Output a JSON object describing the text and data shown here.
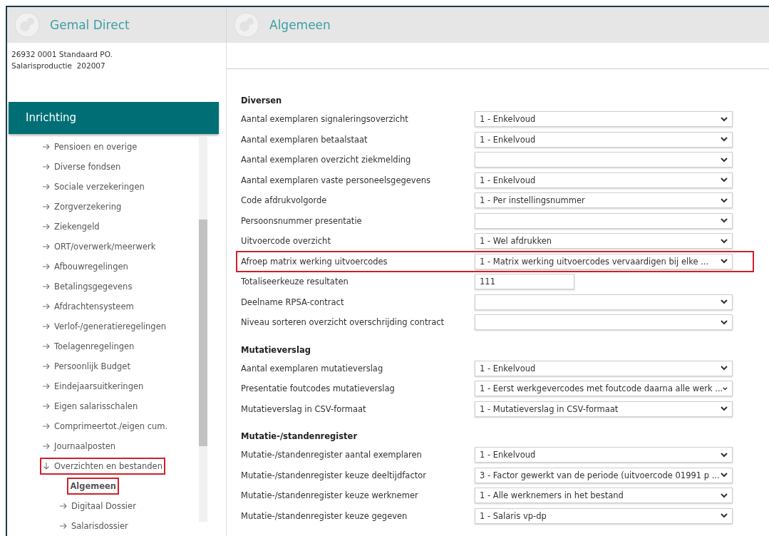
{
  "app_title": "Gemal Direct",
  "page_title": "Algemeen",
  "context": [
    "26932 0001 Standaard PO.",
    "Salarisproductie  202007"
  ],
  "nav_header": "Inrichting",
  "tree": [
    {
      "label": "Pensioen en overige",
      "expanded": false,
      "highlighted": false
    },
    {
      "label": "Diverse fondsen",
      "expanded": false,
      "highlighted": false
    },
    {
      "label": "Sociale verzekeringen",
      "expanded": false,
      "highlighted": false
    },
    {
      "label": "Zorgverzekering",
      "expanded": false,
      "highlighted": false
    },
    {
      "label": "Ziekengeld",
      "expanded": false,
      "highlighted": false
    },
    {
      "label": "ORT/overwerk/meerwerk",
      "expanded": false,
      "highlighted": false
    },
    {
      "label": "Afbouwregelingen",
      "expanded": false,
      "highlighted": false
    },
    {
      "label": "Betalingsgegevens",
      "expanded": false,
      "highlighted": false
    },
    {
      "label": "Afdrachtensysteem",
      "expanded": false,
      "highlighted": false
    },
    {
      "label": "Verlof-/generatieregelingen",
      "expanded": false,
      "highlighted": false
    },
    {
      "label": "Toelagenregelingen",
      "expanded": false,
      "highlighted": false
    },
    {
      "label": "Persoonlijk Budget",
      "expanded": false,
      "highlighted": false
    },
    {
      "label": "Eindejaarsuitkeringen",
      "expanded": false,
      "highlighted": false
    },
    {
      "label": "Eigen salarisschalen",
      "expanded": false,
      "highlighted": false
    },
    {
      "label": "Comprimeertot./eigen cum.",
      "expanded": false,
      "highlighted": false
    },
    {
      "label": "Journaalposten",
      "expanded": false,
      "highlighted": false
    },
    {
      "label": "Overzichten en bestanden",
      "expanded": true,
      "highlighted": true,
      "children": [
        {
          "label": "Algemeen",
          "kind": "page",
          "selected": true,
          "highlighted": true
        },
        {
          "label": "Digitaal Dossier",
          "kind": "group",
          "selected": false,
          "highlighted": false
        },
        {
          "label": "Salarisdossier",
          "kind": "group",
          "selected": false,
          "highlighted": false
        }
      ]
    }
  ],
  "sections": [
    {
      "title": "Diversen",
      "rows": [
        {
          "label": "Aantal exemplaren signaleringsoverzicht",
          "kind": "select",
          "value": "1 - Enkelvoud",
          "highlighted": false
        },
        {
          "label": "Aantal exemplaren betaalstaat",
          "kind": "select",
          "value": "1 - Enkelvoud",
          "highlighted": false
        },
        {
          "label": "Aantal exemplaren overzicht ziekmelding",
          "kind": "select",
          "highlighted": false
        },
        {
          "label": "Aantal exemplaren vaste personeelsgegevens",
          "kind": "select",
          "value": "1 - Enkelvoud",
          "highlighted": false
        },
        {
          "label": "Code afdrukvolgorde",
          "kind": "select",
          "value": "1 - Per instellingsnummer",
          "highlighted": false
        },
        {
          "label": "Persoonsnummer presentatie",
          "kind": "select",
          "highlighted": false
        },
        {
          "label": "Uitvoercode overzicht",
          "kind": "select",
          "value": "1 - Wel afdrukken",
          "highlighted": false
        },
        {
          "label": "Afroep matrix werking uitvoercodes",
          "kind": "select",
          "value": "1 - Matrix werking uitvoercodes vervaardigen bij elke ...",
          "highlighted": true
        },
        {
          "label": "Totaliseerkeuze resultaten",
          "kind": "text",
          "value": "111",
          "highlighted": false
        },
        {
          "label": "Deelname RPSA-contract",
          "kind": "select",
          "highlighted": false
        },
        {
          "label": "Niveau sorteren overzicht overschrijding contract",
          "kind": "select",
          "highlighted": false
        }
      ]
    },
    {
      "title": "Mutatieverslag",
      "rows": [
        {
          "label": "Aantal exemplaren mutatieverslag",
          "kind": "select",
          "value": "1 - Enkelvoud",
          "highlighted": false
        },
        {
          "label": "Presentatie foutcodes mutatieverslag",
          "kind": "select",
          "value": "1 - Eerst werkgevercodes met foutcode daarna alle werk ...",
          "highlighted": false
        },
        {
          "label": "Mutatieverslag in CSV-formaat",
          "kind": "select",
          "value": "1 - Mutatieverslag in CSV-formaat",
          "highlighted": false
        }
      ]
    },
    {
      "title": "Mutatie-/standenregister",
      "rows": [
        {
          "label": "Mutatie-/standenregister aantal exemplaren",
          "kind": "select",
          "value": "1 - Enkelvoud",
          "highlighted": false
        },
        {
          "label": "Mutatie-/standenregister keuze deeltijdfactor",
          "kind": "select",
          "value": "3 - Factor gewerkt van de periode (uitvoercode 01991 p ...",
          "highlighted": false
        },
        {
          "label": "Mutatie-/standenregister keuze werknemer",
          "kind": "select",
          "value": "1 - Alle werknemers in het bestand",
          "highlighted": false
        },
        {
          "label": "Mutatie-/standenregister keuze gegeven",
          "kind": "select",
          "value": "1 - Salaris vp-dp",
          "highlighted": false
        }
      ]
    }
  ]
}
